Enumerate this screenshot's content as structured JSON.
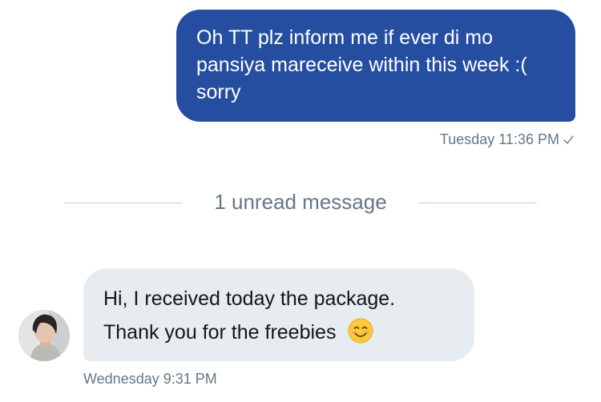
{
  "outgoing": {
    "text": "Oh TT plz inform me if ever di mo pansiya mareceive within this week :( sorry",
    "timestamp": "Tuesday 11:36 PM",
    "bubble_color": "#264ea0"
  },
  "divider": {
    "label": "1 unread message"
  },
  "incoming": {
    "line1": "Hi, I received today the package.",
    "line2": "Thank you for the freebies",
    "timestamp": "Wednesday 9:31 PM",
    "bubble_color": "#e6ecf0",
    "emoji": "smiling-face-emoji"
  },
  "colors": {
    "meta_text": "#657786",
    "divider_line": "#c4cfd6"
  }
}
